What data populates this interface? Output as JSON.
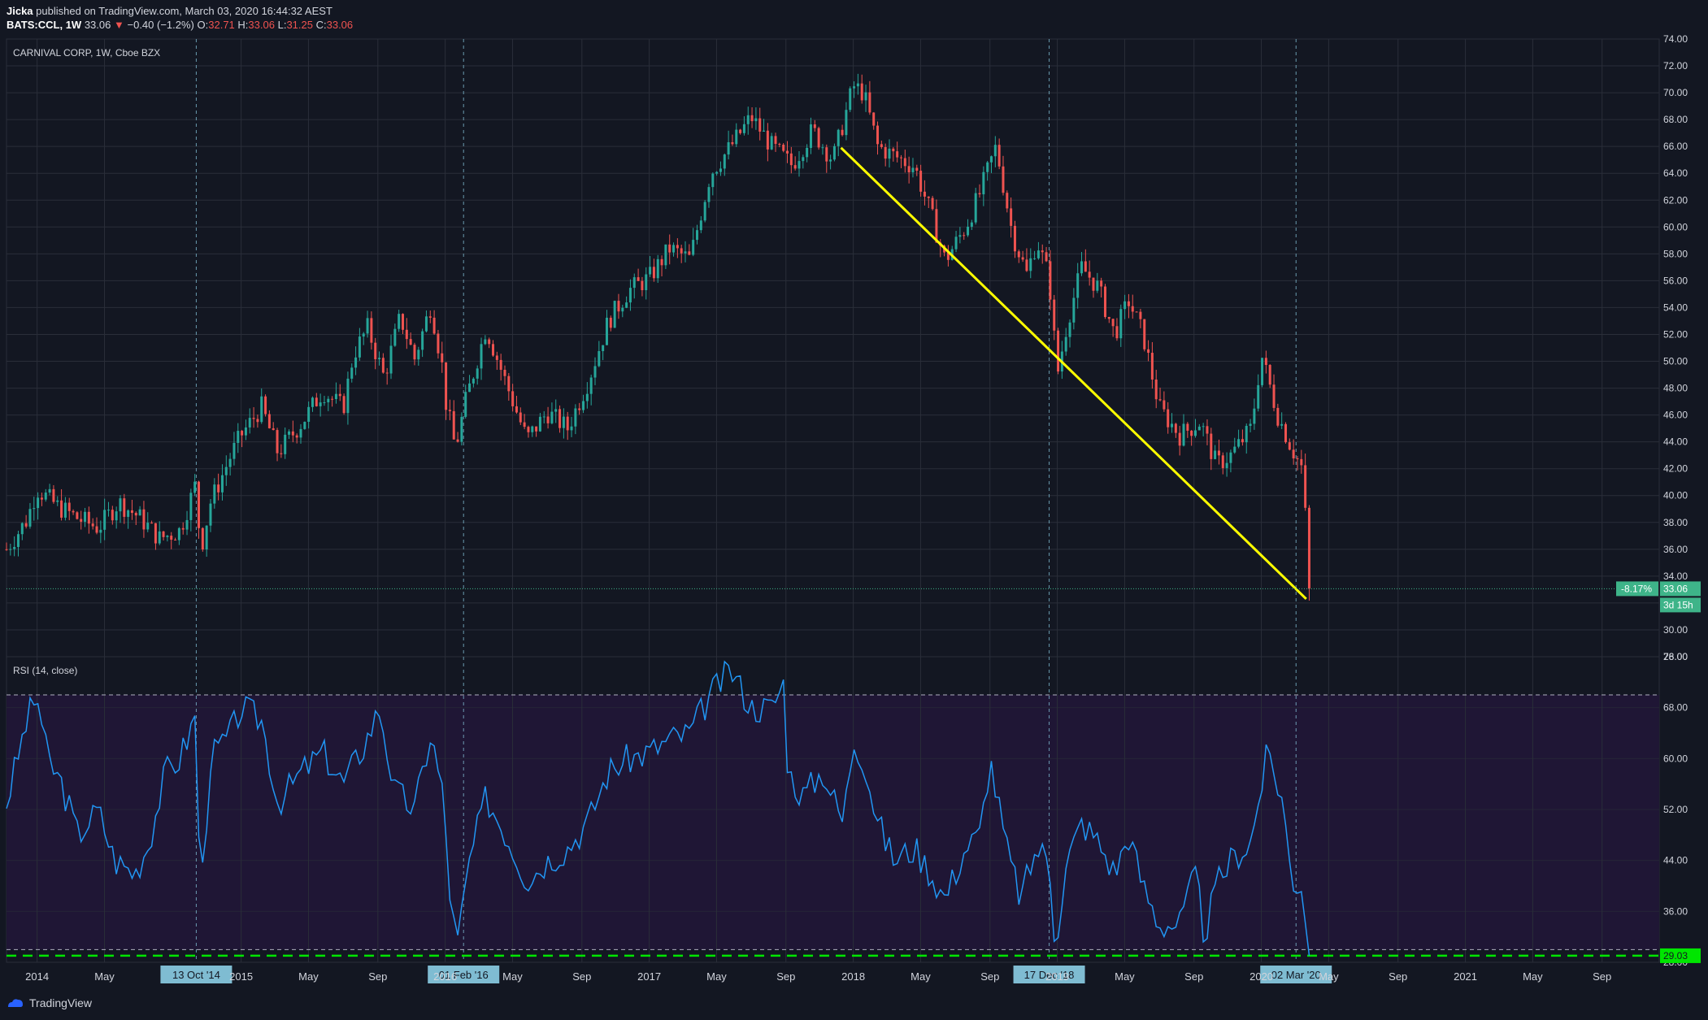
{
  "header": {
    "author": "Jicka",
    "published_text": "published on TradingView.com, March 03, 2020 16:44:32 AEST",
    "symbol": "BATS:CCL, 1W",
    "last": "33.06",
    "change": "−0.40 (−1.2%)",
    "o_label": "O:",
    "o": "32.71",
    "h_label": "H:",
    "h": "33.06",
    "l_label": "L:",
    "l": "31.25",
    "c_label": "C:",
    "c": "33.06"
  },
  "footer": {
    "brand": "TradingView"
  },
  "colors": {
    "background": "#131722",
    "grid": "#2a2e39",
    "up": "#26a69a",
    "down": "#ef5350",
    "trendline": "#ffff00",
    "rsi": "#2196f3",
    "rsi_band": "#1f1635",
    "rsi_level": "#00e600",
    "price_badge": "#3eb489",
    "date_badge": "#7fbcd2"
  },
  "chart_data": [
    {
      "type": "candlestick",
      "title": "CARNIVAL CORP, 1W, Cboe BZX",
      "ylim": [
        28,
        74
      ],
      "y_ticks": [
        "28.00",
        "30.00",
        "32.00",
        "34.00",
        "36.00",
        "38.00",
        "40.00",
        "42.00",
        "44.00",
        "46.00",
        "48.00",
        "50.00",
        "52.00",
        "54.00",
        "56.00",
        "58.00",
        "60.00",
        "62.00",
        "64.00",
        "66.00",
        "68.00",
        "70.00",
        "72.00",
        "74.00"
      ],
      "x_ticks": [
        {
          "label": "2014",
          "t": 2014.0
        },
        {
          "label": "May",
          "t": 2014.33
        },
        {
          "label": "2015",
          "t": 2015.0
        },
        {
          "label": "May",
          "t": 2015.33
        },
        {
          "label": "Sep",
          "t": 2015.67
        },
        {
          "label": "2016",
          "t": 2016.0
        },
        {
          "label": "May",
          "t": 2016.33
        },
        {
          "label": "Sep",
          "t": 2016.67
        },
        {
          "label": "2017",
          "t": 2017.0
        },
        {
          "label": "May",
          "t": 2017.33
        },
        {
          "label": "Sep",
          "t": 2017.67
        },
        {
          "label": "2018",
          "t": 2018.0
        },
        {
          "label": "May",
          "t": 2018.33
        },
        {
          "label": "Sep",
          "t": 2018.67
        },
        {
          "label": "2019",
          "t": 2019.0
        },
        {
          "label": "May",
          "t": 2019.33
        },
        {
          "label": "Sep",
          "t": 2019.67
        },
        {
          "label": "2020",
          "t": 2020.0
        },
        {
          "label": "May",
          "t": 2020.33
        },
        {
          "label": "Sep",
          "t": 2020.67
        },
        {
          "label": "2021",
          "t": 2021.0
        },
        {
          "label": "May",
          "t": 2021.33
        },
        {
          "label": "Sep",
          "t": 2021.67
        }
      ],
      "x_range": [
        2013.85,
        2021.95
      ],
      "close_path": [
        [
          2013.85,
          36.0
        ],
        [
          2013.95,
          38.2
        ],
        [
          2014.0,
          40.5
        ],
        [
          2014.1,
          39.2
        ],
        [
          2014.2,
          38.3
        ],
        [
          2014.3,
          37.6
        ],
        [
          2014.4,
          39.5
        ],
        [
          2014.5,
          38.4
        ],
        [
          2014.6,
          36.8
        ],
        [
          2014.7,
          37.4
        ],
        [
          2014.78,
          41.0
        ],
        [
          2014.8,
          35.8
        ],
        [
          2014.85,
          39.5
        ],
        [
          2014.95,
          43.0
        ],
        [
          2015.0,
          44.5
        ],
        [
          2015.1,
          46.6
        ],
        [
          2015.18,
          43.2
        ],
        [
          2015.3,
          45.5
        ],
        [
          2015.4,
          47.8
        ],
        [
          2015.5,
          46.5
        ],
        [
          2015.55,
          50.5
        ],
        [
          2015.62,
          52.5
        ],
        [
          2015.7,
          48.8
        ],
        [
          2015.78,
          53.3
        ],
        [
          2015.85,
          50.2
        ],
        [
          2015.93,
          54.2
        ],
        [
          2015.99,
          49.2
        ],
        [
          2016.0,
          47.2
        ],
        [
          2016.05,
          43.5
        ],
        [
          2016.1,
          47.0
        ],
        [
          2016.2,
          52.5
        ],
        [
          2016.3,
          48.3
        ],
        [
          2016.4,
          44.2
        ],
        [
          2016.5,
          46.2
        ],
        [
          2016.6,
          45.0
        ],
        [
          2016.7,
          48.5
        ],
        [
          2016.8,
          53.0
        ],
        [
          2016.9,
          55.3
        ],
        [
          2017.0,
          56.2
        ],
        [
          2017.1,
          58.4
        ],
        [
          2017.2,
          57.6
        ],
        [
          2017.3,
          64.0
        ],
        [
          2017.4,
          66.0
        ],
        [
          2017.5,
          68.2
        ],
        [
          2017.6,
          66.0
        ],
        [
          2017.7,
          64.6
        ],
        [
          2017.8,
          67.2
        ],
        [
          2017.9,
          65.0
        ],
        [
          2018.0,
          70.5
        ],
        [
          2018.05,
          70.0
        ],
        [
          2018.12,
          66.0
        ],
        [
          2018.2,
          65.3
        ],
        [
          2018.3,
          64.5
        ],
        [
          2018.38,
          61.0
        ],
        [
          2018.45,
          57.5
        ],
        [
          2018.55,
          60.0
        ],
        [
          2018.62,
          62.5
        ],
        [
          2018.7,
          66.0
        ],
        [
          2018.78,
          59.5
        ],
        [
          2018.85,
          56.5
        ],
        [
          2018.9,
          59.0
        ],
        [
          2018.96,
          56.2
        ],
        [
          2019.0,
          49.0
        ],
        [
          2019.05,
          53.0
        ],
        [
          2019.12,
          57.0
        ],
        [
          2019.2,
          55.5
        ],
        [
          2019.28,
          52.0
        ],
        [
          2019.35,
          54.5
        ],
        [
          2019.42,
          52.0
        ],
        [
          2019.5,
          46.5
        ],
        [
          2019.6,
          44.5
        ],
        [
          2019.7,
          45.5
        ],
        [
          2019.78,
          42.3
        ],
        [
          2019.85,
          43.0
        ],
        [
          2019.95,
          45.0
        ],
        [
          2020.0,
          50.5
        ],
        [
          2020.08,
          46.0
        ],
        [
          2020.15,
          43.5
        ],
        [
          2020.2,
          42.0
        ],
        [
          2020.24,
          33.06
        ]
      ],
      "trendline": [
        [
          2017.94,
          65.9
        ],
        [
          2020.22,
          32.3
        ]
      ],
      "last_price": 33.06,
      "last_price_label": "33.06",
      "change_label": "-8.17%",
      "countdown_label": "3d 15h"
    },
    {
      "type": "line",
      "title": "RSI (14, close)",
      "ylim": [
        28,
        76
      ],
      "y_ticks": [
        "28.00",
        "36.00",
        "44.00",
        "52.00",
        "60.00",
        "68.00",
        "76.00"
      ],
      "upper_band": 70,
      "lower_band": 30,
      "rsi_path": [
        [
          2013.85,
          53
        ],
        [
          2013.95,
          66
        ],
        [
          2014.0,
          70
        ],
        [
          2014.05,
          60
        ],
        [
          2014.12,
          56
        ],
        [
          2014.2,
          48
        ],
        [
          2014.3,
          52
        ],
        [
          2014.38,
          44
        ],
        [
          2014.48,
          42
        ],
        [
          2014.55,
          47
        ],
        [
          2014.63,
          58
        ],
        [
          2014.7,
          60
        ],
        [
          2014.78,
          67
        ],
        [
          2014.8,
          37
        ],
        [
          2014.85,
          60
        ],
        [
          2014.95,
          64
        ],
        [
          2015.0,
          68
        ],
        [
          2015.1,
          66
        ],
        [
          2015.18,
          53
        ],
        [
          2015.3,
          58
        ],
        [
          2015.4,
          61
        ],
        [
          2015.5,
          56
        ],
        [
          2015.6,
          62
        ],
        [
          2015.68,
          68
        ],
        [
          2015.75,
          55
        ],
        [
          2015.85,
          52
        ],
        [
          2015.93,
          64
        ],
        [
          2015.99,
          54
        ],
        [
          2016.03,
          36
        ],
        [
          2016.06,
          31
        ],
        [
          2016.12,
          44
        ],
        [
          2016.2,
          54
        ],
        [
          2016.3,
          48
        ],
        [
          2016.4,
          41
        ],
        [
          2016.5,
          44
        ],
        [
          2016.6,
          46
        ],
        [
          2016.7,
          50
        ],
        [
          2016.8,
          58
        ],
        [
          2016.9,
          60
        ],
        [
          2017.0,
          61
        ],
        [
          2017.1,
          63
        ],
        [
          2017.2,
          64
        ],
        [
          2017.3,
          70
        ],
        [
          2017.4,
          74
        ],
        [
          2017.5,
          68
        ],
        [
          2017.6,
          68
        ],
        [
          2017.66,
          72
        ],
        [
          2017.68,
          58
        ],
        [
          2017.75,
          54
        ],
        [
          2017.85,
          58
        ],
        [
          2017.95,
          50
        ],
        [
          2018.0,
          63
        ],
        [
          2018.05,
          60
        ],
        [
          2018.12,
          50
        ],
        [
          2018.2,
          44
        ],
        [
          2018.3,
          46
        ],
        [
          2018.38,
          42
        ],
        [
          2018.45,
          38
        ],
        [
          2018.55,
          46
        ],
        [
          2018.62,
          48
        ],
        [
          2018.67,
          60
        ],
        [
          2018.75,
          46
        ],
        [
          2018.82,
          38
        ],
        [
          2018.9,
          46
        ],
        [
          2018.96,
          44
        ],
        [
          2018.99,
          31
        ],
        [
          2019.05,
          44
        ],
        [
          2019.12,
          50
        ],
        [
          2019.2,
          47
        ],
        [
          2019.28,
          42
        ],
        [
          2019.35,
          48
        ],
        [
          2019.42,
          40
        ],
        [
          2019.5,
          34
        ],
        [
          2019.6,
          34
        ],
        [
          2019.68,
          42
        ],
        [
          2019.72,
          32
        ],
        [
          2019.78,
          40
        ],
        [
          2019.85,
          44
        ],
        [
          2019.95,
          47
        ],
        [
          2020.03,
          61
        ],
        [
          2020.1,
          54
        ],
        [
          2020.15,
          41
        ],
        [
          2020.2,
          40
        ],
        [
          2020.24,
          29.03
        ]
      ],
      "last_value_label": "29.03"
    }
  ],
  "markers": [
    {
      "label": "13 Oct '14",
      "t": 2014.78
    },
    {
      "label": "01 Feb '16",
      "t": 2016.09
    },
    {
      "label": "17 Dec '18",
      "t": 2018.96
    },
    {
      "label": "02 Mar '20",
      "t": 2020.17
    }
  ]
}
